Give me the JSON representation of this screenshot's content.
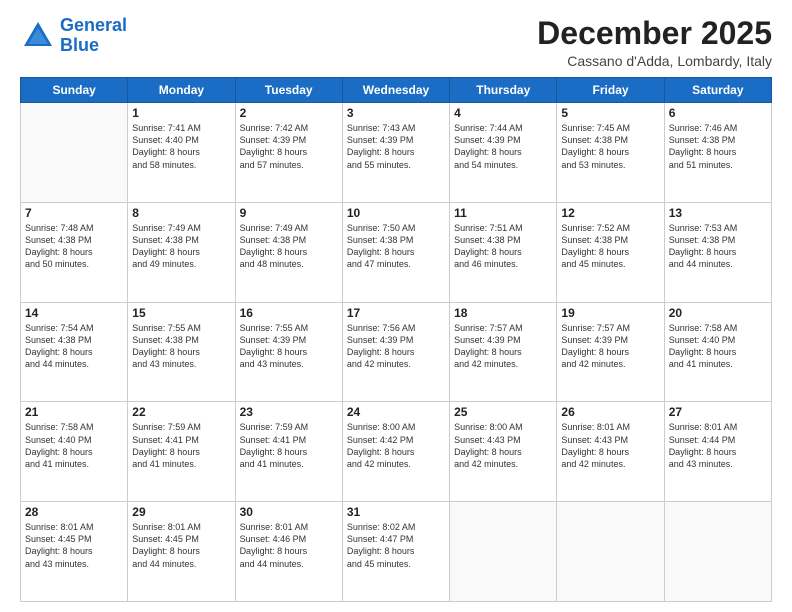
{
  "header": {
    "logo_line1": "General",
    "logo_line2": "Blue",
    "month": "December 2025",
    "location": "Cassano d'Adda, Lombardy, Italy"
  },
  "weekdays": [
    "Sunday",
    "Monday",
    "Tuesday",
    "Wednesday",
    "Thursday",
    "Friday",
    "Saturday"
  ],
  "weeks": [
    [
      {
        "day": "",
        "info": ""
      },
      {
        "day": "1",
        "info": "Sunrise: 7:41 AM\nSunset: 4:40 PM\nDaylight: 8 hours\nand 58 minutes."
      },
      {
        "day": "2",
        "info": "Sunrise: 7:42 AM\nSunset: 4:39 PM\nDaylight: 8 hours\nand 57 minutes."
      },
      {
        "day": "3",
        "info": "Sunrise: 7:43 AM\nSunset: 4:39 PM\nDaylight: 8 hours\nand 55 minutes."
      },
      {
        "day": "4",
        "info": "Sunrise: 7:44 AM\nSunset: 4:39 PM\nDaylight: 8 hours\nand 54 minutes."
      },
      {
        "day": "5",
        "info": "Sunrise: 7:45 AM\nSunset: 4:38 PM\nDaylight: 8 hours\nand 53 minutes."
      },
      {
        "day": "6",
        "info": "Sunrise: 7:46 AM\nSunset: 4:38 PM\nDaylight: 8 hours\nand 51 minutes."
      }
    ],
    [
      {
        "day": "7",
        "info": "Sunrise: 7:48 AM\nSunset: 4:38 PM\nDaylight: 8 hours\nand 50 minutes."
      },
      {
        "day": "8",
        "info": "Sunrise: 7:49 AM\nSunset: 4:38 PM\nDaylight: 8 hours\nand 49 minutes."
      },
      {
        "day": "9",
        "info": "Sunrise: 7:49 AM\nSunset: 4:38 PM\nDaylight: 8 hours\nand 48 minutes."
      },
      {
        "day": "10",
        "info": "Sunrise: 7:50 AM\nSunset: 4:38 PM\nDaylight: 8 hours\nand 47 minutes."
      },
      {
        "day": "11",
        "info": "Sunrise: 7:51 AM\nSunset: 4:38 PM\nDaylight: 8 hours\nand 46 minutes."
      },
      {
        "day": "12",
        "info": "Sunrise: 7:52 AM\nSunset: 4:38 PM\nDaylight: 8 hours\nand 45 minutes."
      },
      {
        "day": "13",
        "info": "Sunrise: 7:53 AM\nSunset: 4:38 PM\nDaylight: 8 hours\nand 44 minutes."
      }
    ],
    [
      {
        "day": "14",
        "info": "Sunrise: 7:54 AM\nSunset: 4:38 PM\nDaylight: 8 hours\nand 44 minutes."
      },
      {
        "day": "15",
        "info": "Sunrise: 7:55 AM\nSunset: 4:38 PM\nDaylight: 8 hours\nand 43 minutes."
      },
      {
        "day": "16",
        "info": "Sunrise: 7:55 AM\nSunset: 4:39 PM\nDaylight: 8 hours\nand 43 minutes."
      },
      {
        "day": "17",
        "info": "Sunrise: 7:56 AM\nSunset: 4:39 PM\nDaylight: 8 hours\nand 42 minutes."
      },
      {
        "day": "18",
        "info": "Sunrise: 7:57 AM\nSunset: 4:39 PM\nDaylight: 8 hours\nand 42 minutes."
      },
      {
        "day": "19",
        "info": "Sunrise: 7:57 AM\nSunset: 4:39 PM\nDaylight: 8 hours\nand 42 minutes."
      },
      {
        "day": "20",
        "info": "Sunrise: 7:58 AM\nSunset: 4:40 PM\nDaylight: 8 hours\nand 41 minutes."
      }
    ],
    [
      {
        "day": "21",
        "info": "Sunrise: 7:58 AM\nSunset: 4:40 PM\nDaylight: 8 hours\nand 41 minutes."
      },
      {
        "day": "22",
        "info": "Sunrise: 7:59 AM\nSunset: 4:41 PM\nDaylight: 8 hours\nand 41 minutes."
      },
      {
        "day": "23",
        "info": "Sunrise: 7:59 AM\nSunset: 4:41 PM\nDaylight: 8 hours\nand 41 minutes."
      },
      {
        "day": "24",
        "info": "Sunrise: 8:00 AM\nSunset: 4:42 PM\nDaylight: 8 hours\nand 42 minutes."
      },
      {
        "day": "25",
        "info": "Sunrise: 8:00 AM\nSunset: 4:43 PM\nDaylight: 8 hours\nand 42 minutes."
      },
      {
        "day": "26",
        "info": "Sunrise: 8:01 AM\nSunset: 4:43 PM\nDaylight: 8 hours\nand 42 minutes."
      },
      {
        "day": "27",
        "info": "Sunrise: 8:01 AM\nSunset: 4:44 PM\nDaylight: 8 hours\nand 43 minutes."
      }
    ],
    [
      {
        "day": "28",
        "info": "Sunrise: 8:01 AM\nSunset: 4:45 PM\nDaylight: 8 hours\nand 43 minutes."
      },
      {
        "day": "29",
        "info": "Sunrise: 8:01 AM\nSunset: 4:45 PM\nDaylight: 8 hours\nand 44 minutes."
      },
      {
        "day": "30",
        "info": "Sunrise: 8:01 AM\nSunset: 4:46 PM\nDaylight: 8 hours\nand 44 minutes."
      },
      {
        "day": "31",
        "info": "Sunrise: 8:02 AM\nSunset: 4:47 PM\nDaylight: 8 hours\nand 45 minutes."
      },
      {
        "day": "",
        "info": ""
      },
      {
        "day": "",
        "info": ""
      },
      {
        "day": "",
        "info": ""
      }
    ]
  ]
}
